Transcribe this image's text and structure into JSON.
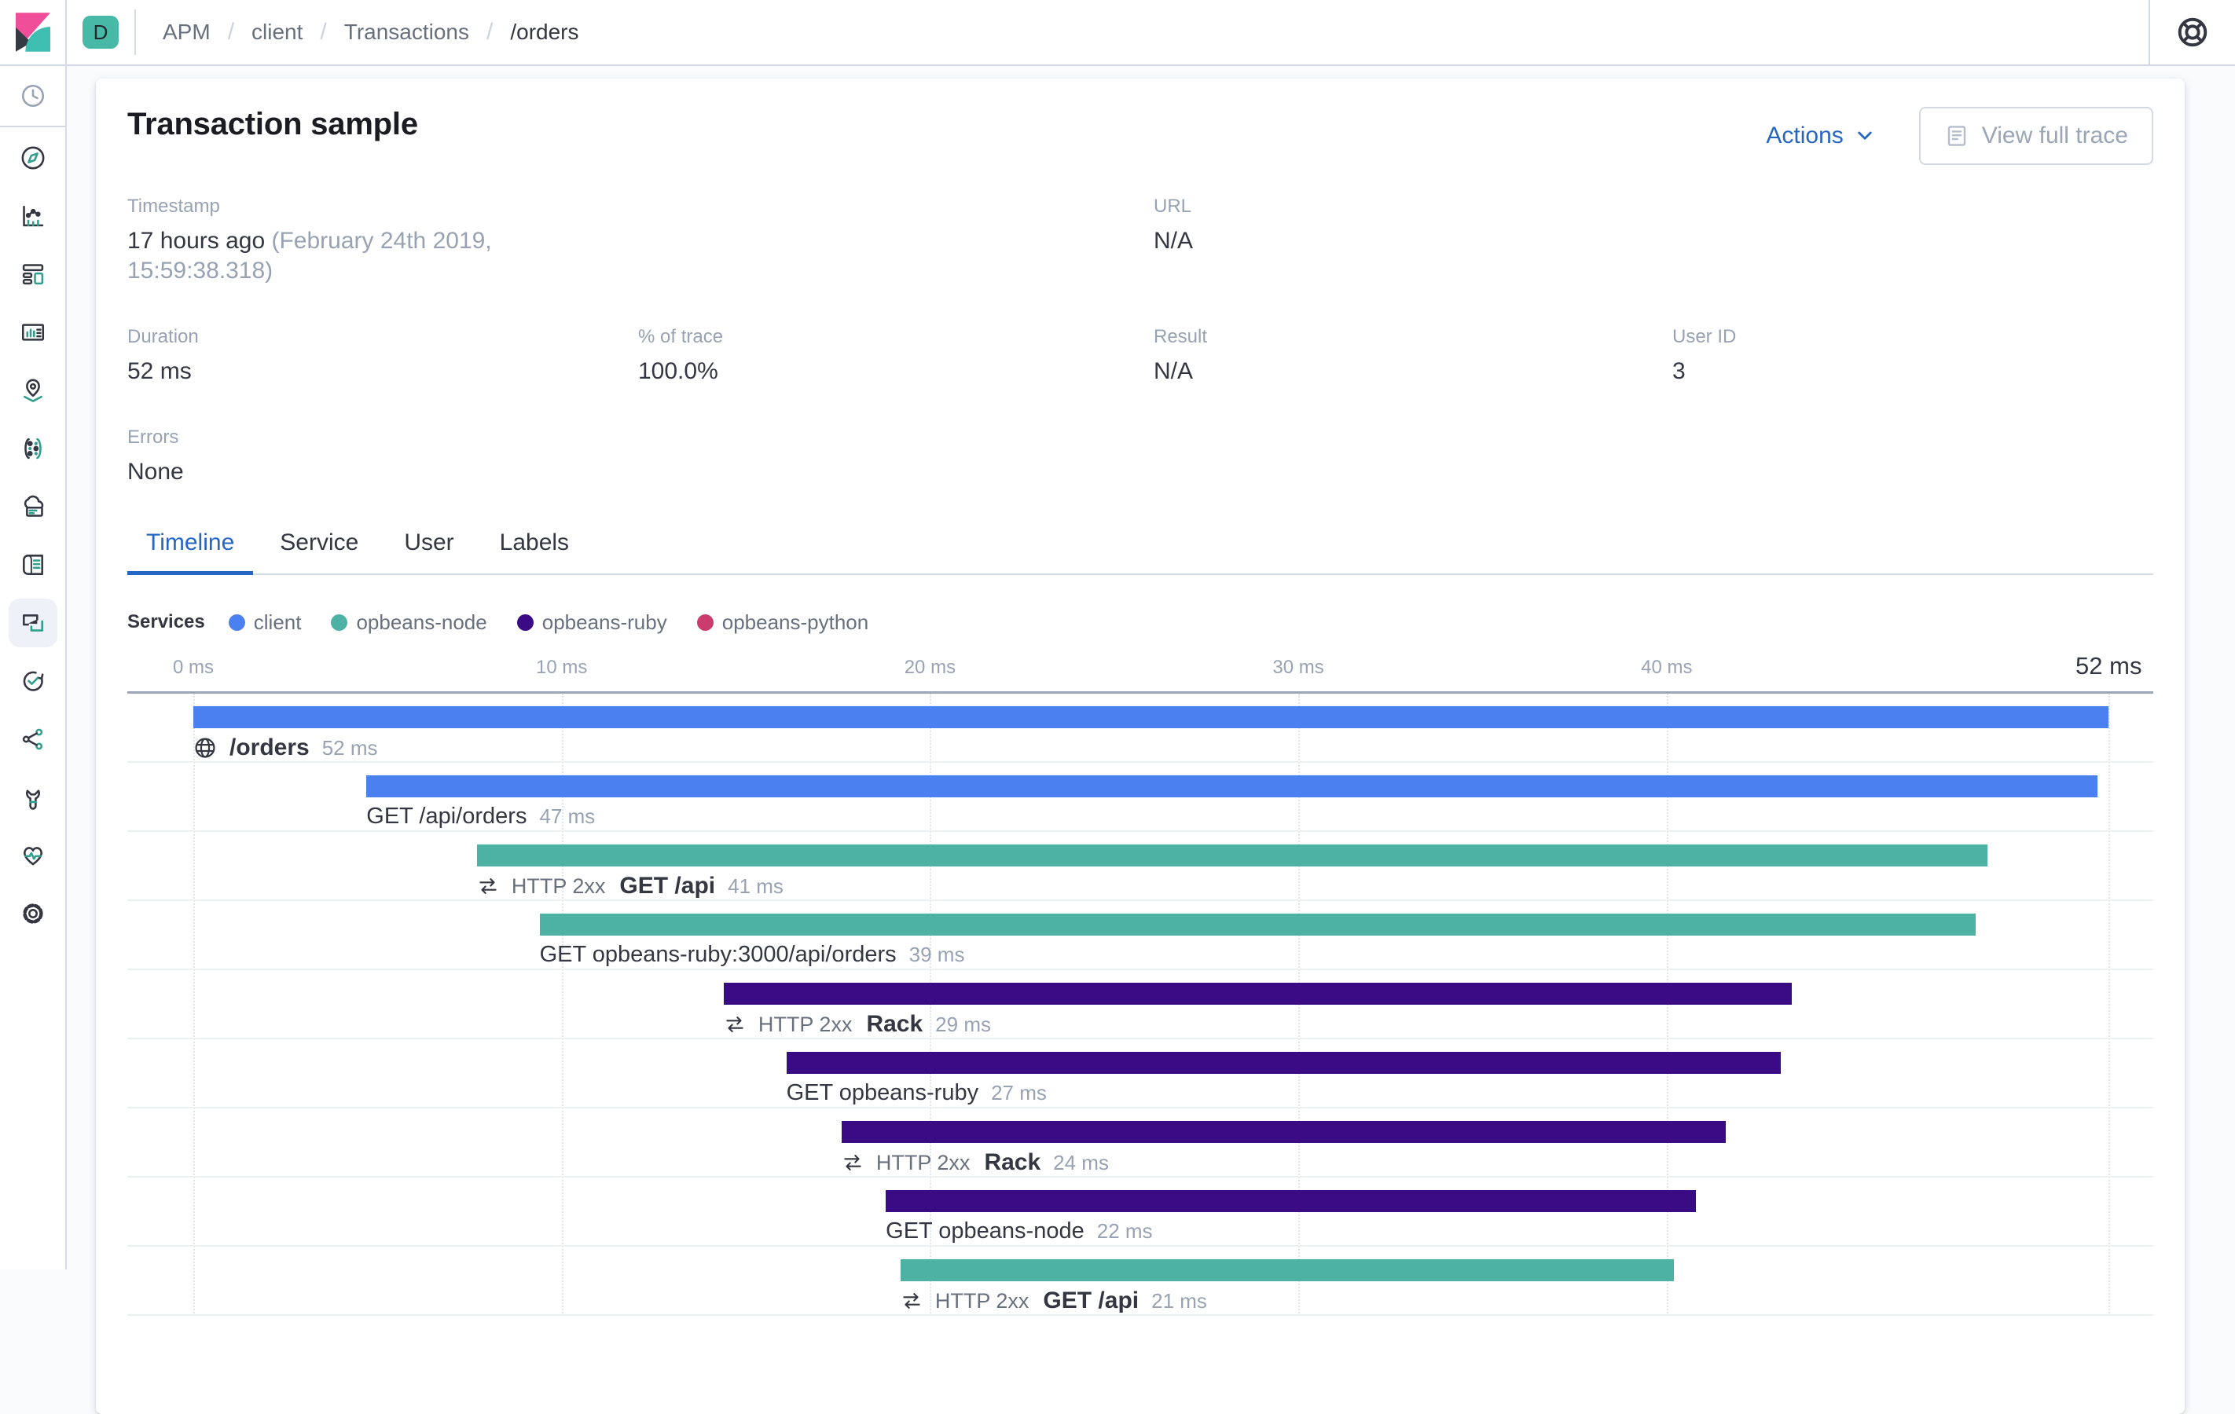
{
  "header": {
    "space_initial": "D",
    "breadcrumbs": [
      {
        "label": "APM",
        "current": false
      },
      {
        "label": "client",
        "current": false
      },
      {
        "label": "Transactions",
        "current": false
      },
      {
        "label": "/orders",
        "current": true
      }
    ]
  },
  "sidebar": {
    "recent": {
      "id": "recently-viewed",
      "icon": "clock-icon"
    },
    "items": [
      {
        "id": "discover",
        "icon": "compass-icon",
        "active": false
      },
      {
        "id": "visualize",
        "icon": "visualize-icon",
        "active": false
      },
      {
        "id": "dashboard",
        "icon": "dashboard-icon",
        "active": false
      },
      {
        "id": "canvas",
        "icon": "canvas-icon",
        "active": false
      },
      {
        "id": "maps",
        "icon": "maps-icon",
        "active": false
      },
      {
        "id": "machine-learning",
        "icon": "ml-icon",
        "active": false
      },
      {
        "id": "infrastructure",
        "icon": "infra-icon",
        "active": false
      },
      {
        "id": "logs",
        "icon": "logs-icon",
        "active": false
      },
      {
        "id": "apm",
        "icon": "apm-icon",
        "active": true
      },
      {
        "id": "uptime",
        "icon": "uptime-icon",
        "active": false
      },
      {
        "id": "graph",
        "icon": "graph-icon",
        "active": false
      },
      {
        "id": "dev-tools",
        "icon": "devtools-icon",
        "active": false
      },
      {
        "id": "monitoring",
        "icon": "monitoring-icon",
        "active": false
      },
      {
        "id": "management",
        "icon": "gear-icon",
        "active": false
      }
    ]
  },
  "panel": {
    "title": "Transaction sample",
    "actions_label": "Actions",
    "view_full_trace_label": "View full trace",
    "fields": [
      {
        "label": "Timestamp",
        "value": "17 hours ago",
        "value_secondary": "(February 24th 2019, 15:59:38.318)",
        "col": 1,
        "row": 1
      },
      {
        "label": "URL",
        "value": "N/A",
        "col": 3,
        "row": 1
      },
      {
        "label": "Duration",
        "value": "52 ms",
        "col": 1,
        "row": 2
      },
      {
        "label": "% of trace",
        "value": "100.0%",
        "col": 2,
        "row": 2
      },
      {
        "label": "Result",
        "value": "N/A",
        "col": 3,
        "row": 2
      },
      {
        "label": "User ID",
        "value": "3",
        "col": 4,
        "row": 2
      },
      {
        "label": "Errors",
        "value": "None",
        "col": 1,
        "row": 3
      }
    ],
    "tabs": [
      {
        "label": "Timeline",
        "active": true
      },
      {
        "label": "Service",
        "active": false
      },
      {
        "label": "User",
        "active": false
      },
      {
        "label": "Labels",
        "active": false
      }
    ],
    "legend": {
      "title": "Services",
      "services": [
        {
          "name": "client",
          "color": "#4a80f0"
        },
        {
          "name": "opbeans-node",
          "color": "#4db2a4"
        },
        {
          "name": "opbeans-ruby",
          "color": "#3b0a85"
        },
        {
          "name": "opbeans-python",
          "color": "#ca3c6e"
        }
      ]
    }
  },
  "chart_data": {
    "type": "waterfall-timeline",
    "total_ms": 52,
    "axis_ticks": [
      {
        "ms": 0,
        "label": "0 ms"
      },
      {
        "ms": 10,
        "label": "10 ms"
      },
      {
        "ms": 20,
        "label": "20 ms"
      },
      {
        "ms": 30,
        "label": "30 ms"
      },
      {
        "ms": 40,
        "label": "40 ms"
      }
    ],
    "axis_end": {
      "ms": 52,
      "label": "52 ms"
    },
    "items": [
      {
        "kind": "transaction",
        "service": "client",
        "icon": "globe-icon",
        "result": "",
        "name": "/orders",
        "duration_label": "52 ms",
        "start_ms": 0,
        "duration_ms": 52
      },
      {
        "kind": "span",
        "service": "client",
        "icon": "",
        "result": "",
        "name": "GET /api/orders",
        "duration_label": "47 ms",
        "start_ms": 4.7,
        "duration_ms": 47
      },
      {
        "kind": "transaction",
        "service": "opbeans-node",
        "icon": "transaction-icon",
        "result": "HTTP 2xx",
        "name": "GET /api",
        "duration_label": "41 ms",
        "start_ms": 7.7,
        "duration_ms": 41
      },
      {
        "kind": "span",
        "service": "opbeans-node",
        "icon": "",
        "result": "",
        "name": "GET opbeans-ruby:3000/api/orders",
        "duration_label": "39 ms",
        "start_ms": 9.4,
        "duration_ms": 39
      },
      {
        "kind": "transaction",
        "service": "opbeans-ruby",
        "icon": "transaction-icon",
        "result": "HTTP 2xx",
        "name": "Rack",
        "duration_label": "29 ms",
        "start_ms": 14.4,
        "duration_ms": 29
      },
      {
        "kind": "span",
        "service": "opbeans-ruby",
        "icon": "",
        "result": "",
        "name": "GET opbeans-ruby",
        "duration_label": "27 ms",
        "start_ms": 16.1,
        "duration_ms": 27
      },
      {
        "kind": "transaction",
        "service": "opbeans-ruby",
        "icon": "transaction-icon",
        "result": "HTTP 2xx",
        "name": "Rack",
        "duration_label": "24 ms",
        "start_ms": 17.6,
        "duration_ms": 24
      },
      {
        "kind": "span",
        "service": "opbeans-ruby",
        "icon": "",
        "result": "",
        "name": "GET opbeans-node",
        "duration_label": "22 ms",
        "start_ms": 18.8,
        "duration_ms": 22
      },
      {
        "kind": "transaction",
        "service": "opbeans-node",
        "icon": "transaction-icon",
        "result": "HTTP 2xx",
        "name": "GET /api",
        "duration_label": "21 ms",
        "start_ms": 19.2,
        "duration_ms": 21
      }
    ]
  }
}
